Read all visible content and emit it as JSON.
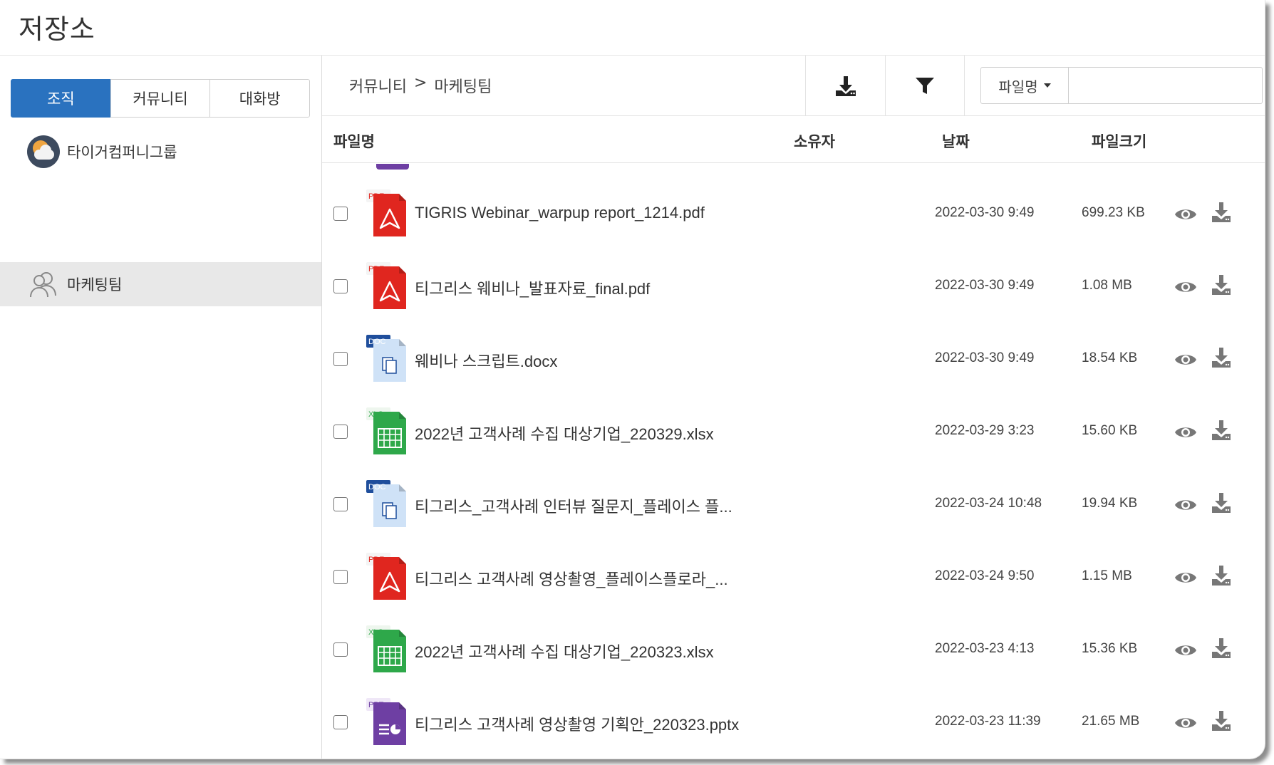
{
  "app": {
    "title": "저장소"
  },
  "sidebar": {
    "tabs": [
      {
        "label": "조직",
        "active": true
      },
      {
        "label": "커뮤니티",
        "active": false
      },
      {
        "label": "대화방",
        "active": false
      }
    ],
    "org": {
      "name": "타이거컴퍼니그룹",
      "icon": "cloud-sun-logo"
    },
    "team": {
      "name": "마케팅팀",
      "icon": "users-icon",
      "selected": true
    }
  },
  "toolbar": {
    "breadcrumb": [
      "커뮤니티",
      ">",
      "마케팅팀"
    ],
    "download_icon": "download-icon",
    "filter_icon": "filter-icon",
    "search_field_label": "파일명",
    "search_value": ""
  },
  "table": {
    "columns": {
      "name": "파일명",
      "owner": "소유자",
      "date": "날짜",
      "size": "파일크기"
    },
    "rows": [
      {
        "type": "pdf",
        "name": "TIGRIS Webinar_warpup report_1214.pdf",
        "owner": "",
        "date": "2022-03-30 9:49",
        "size": "699.23 KB"
      },
      {
        "type": "pdf",
        "name": "티그리스 웨비나_발표자료_final.pdf",
        "owner": "",
        "date": "2022-03-30 9:49",
        "size": "1.08 MB"
      },
      {
        "type": "doc",
        "name": "웨비나 스크립트.docx",
        "owner": "",
        "date": "2022-03-30 9:49",
        "size": "18.54 KB"
      },
      {
        "type": "xls",
        "name": "2022년 고객사례 수집 대상기업_220329.xlsx",
        "owner": "",
        "date": "2022-03-29 3:23",
        "size": "15.60 KB"
      },
      {
        "type": "doc",
        "name": "티그리스_고객사례 인터뷰 질문지_플레이스 플...",
        "owner": "",
        "date": "2022-03-24 10:48",
        "size": "19.94 KB"
      },
      {
        "type": "pdf",
        "name": "티그리스 고객사례 영상촬영_플레이스플로라_...",
        "owner": "",
        "date": "2022-03-24 9:50",
        "size": "1.15 MB"
      },
      {
        "type": "xls",
        "name": "2022년 고객사례 수집 대상기업_220323.xlsx",
        "owner": "",
        "date": "2022-03-23 4:13",
        "size": "15.36 KB"
      },
      {
        "type": "ppt",
        "name": "티그리스 고객사례 영상촬영 기획안_220323.pptx",
        "owner": "",
        "date": "2022-03-23 11:39",
        "size": "21.65 MB"
      }
    ],
    "file_type_tags": {
      "pdf": "PDF",
      "doc": "DOC",
      "xls": "XLS",
      "ppt": "PPT"
    },
    "row_actions": [
      "eye-icon",
      "download-icon"
    ]
  },
  "colors": {
    "accent": "#2a72bf",
    "pdf": "#e0261f",
    "doc": "#1f4e9c",
    "xls": "#2ea84a",
    "ppt": "#6e3fa3"
  }
}
